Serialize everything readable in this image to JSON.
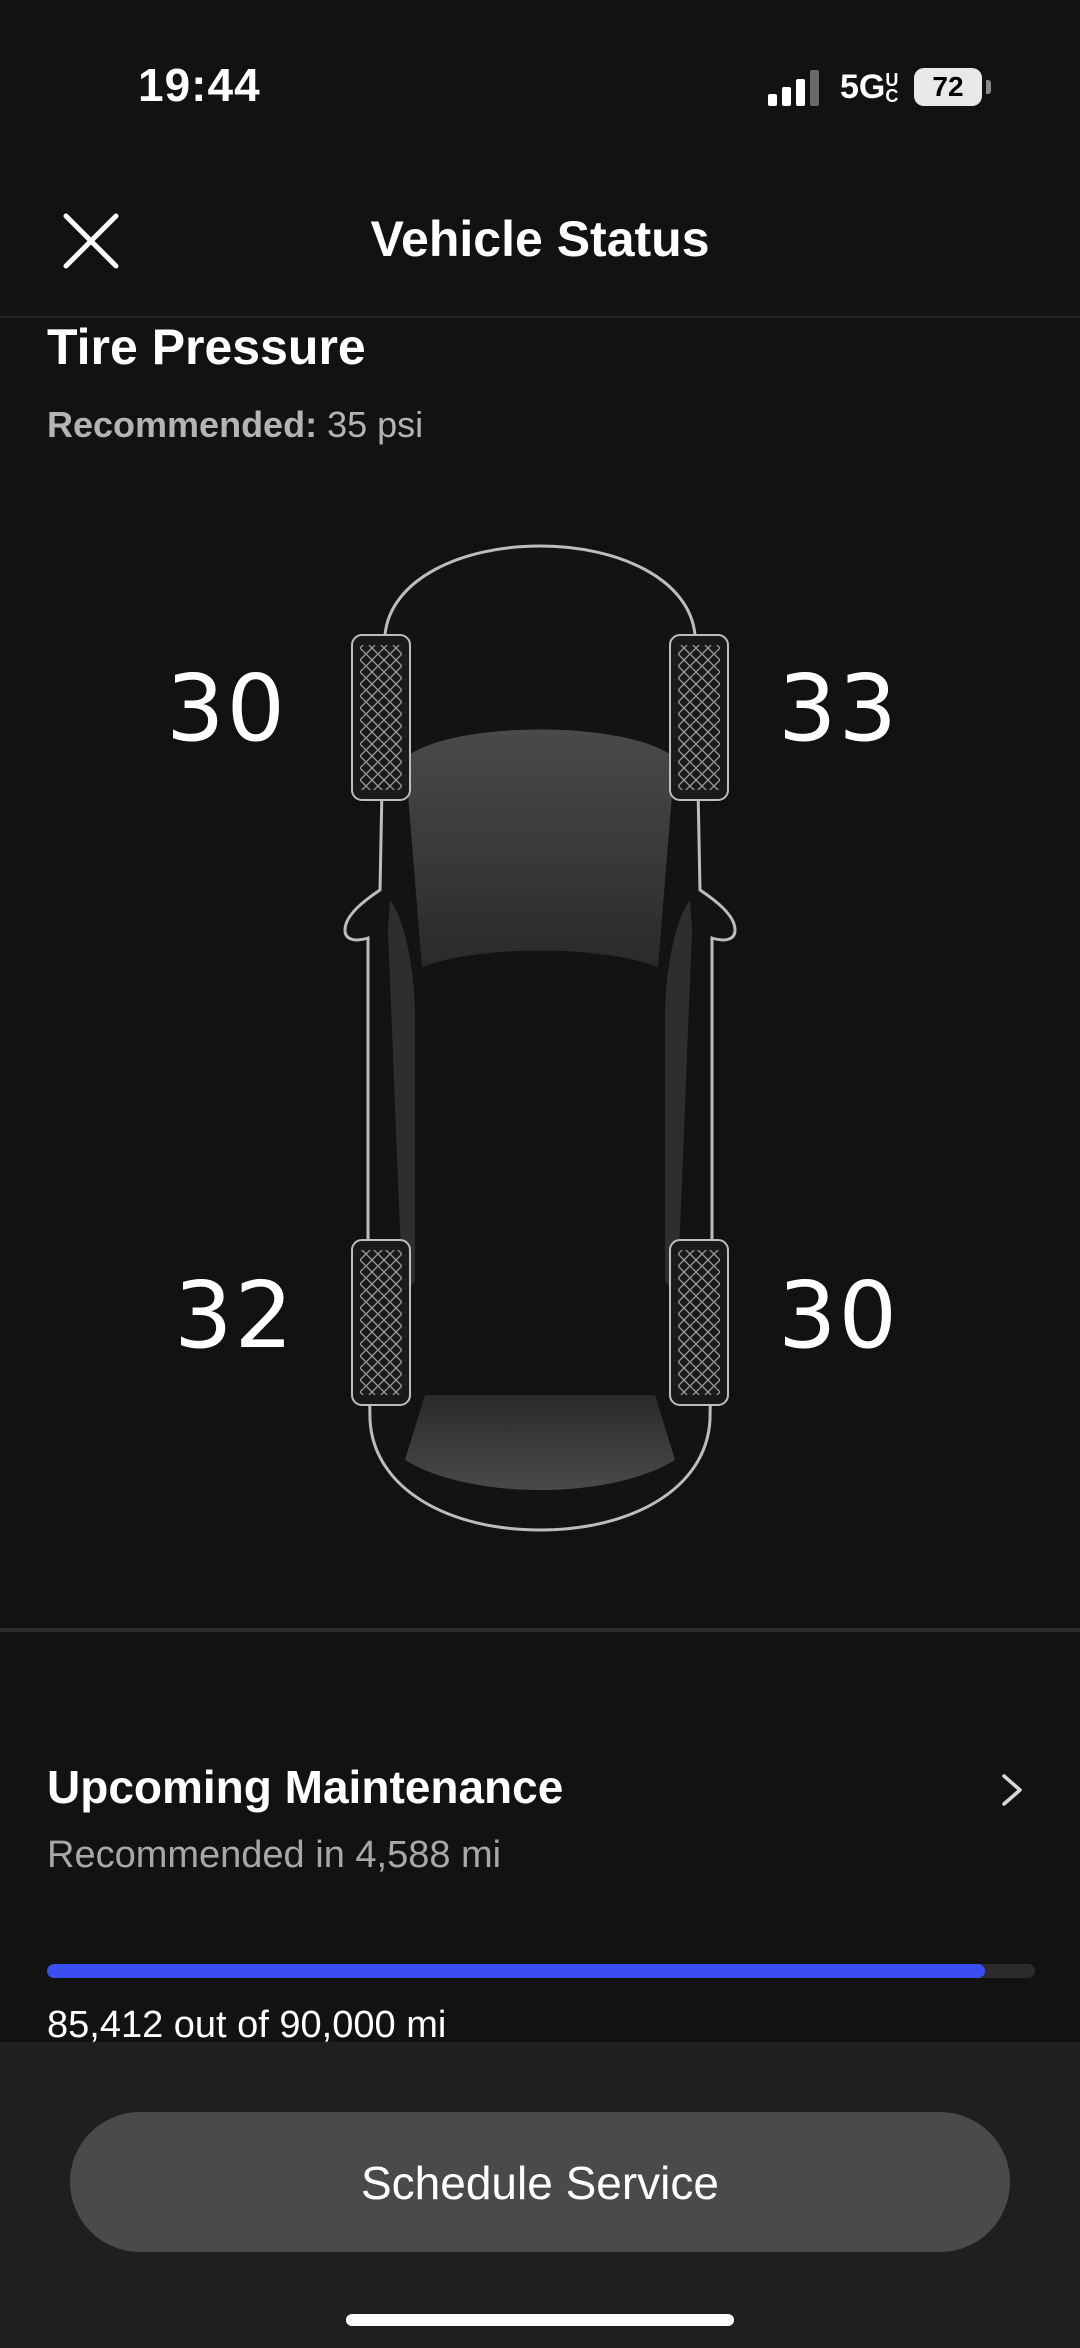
{
  "status_bar": {
    "time": "19:44",
    "network": "5G",
    "network_suffix": "UC",
    "battery": "72"
  },
  "header": {
    "title": "Vehicle Status",
    "close_icon": "close-icon"
  },
  "tire_pressure": {
    "title": "Tire Pressure",
    "recommended_label": "Recommended:",
    "recommended_value": "35 psi",
    "front_left": "30",
    "front_right": "33",
    "rear_left": "32",
    "rear_right": "30"
  },
  "maintenance": {
    "title": "Upcoming Maintenance",
    "subtitle": "Recommended in 4,588 mi",
    "progress": 0.949,
    "odometer_text": "85,412 out of 90,000 mi",
    "accent_color": "#3b4ef0"
  },
  "actions": {
    "schedule_label": "Schedule Service"
  }
}
